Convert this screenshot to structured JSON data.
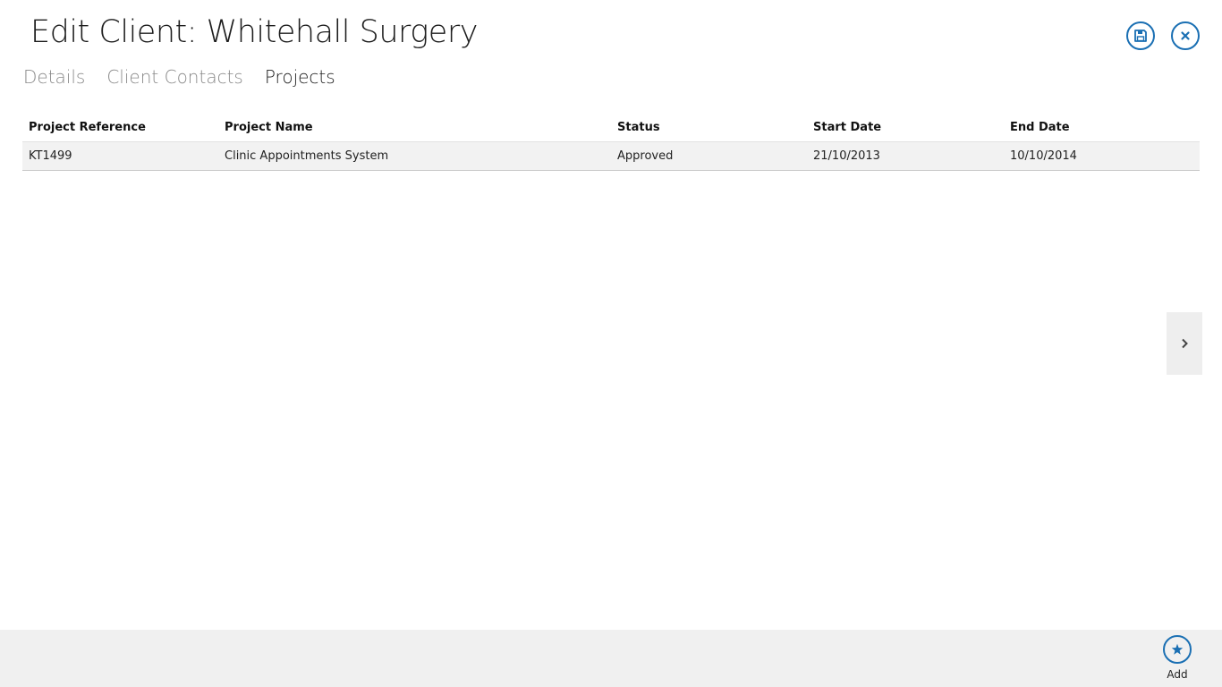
{
  "header": {
    "title": "Edit Client: Whitehall Surgery",
    "save_icon": "save-icon",
    "close_icon": "close-icon"
  },
  "tabs": [
    {
      "label": "Details",
      "active": false
    },
    {
      "label": "Client Contacts",
      "active": false
    },
    {
      "label": "Projects",
      "active": true
    }
  ],
  "projects_table": {
    "columns": [
      "Project Reference",
      "Project Name",
      "Status",
      "Start Date",
      "End Date"
    ],
    "rows": [
      {
        "reference": "KT1499",
        "name": "Clinic Appointments System",
        "status": "Approved",
        "start_date": "21/10/2013",
        "end_date": "10/10/2014"
      }
    ]
  },
  "side_nav": {
    "icon": "chevron-right-icon"
  },
  "app_bar": {
    "add_label": "Add",
    "add_icon": "star-icon"
  },
  "colors": {
    "accent": "#1a6fb3",
    "app_bar_bg": "#f0f0f0",
    "row_bg": "#f2f2f2",
    "inactive_tab": "#8a8a8a"
  }
}
